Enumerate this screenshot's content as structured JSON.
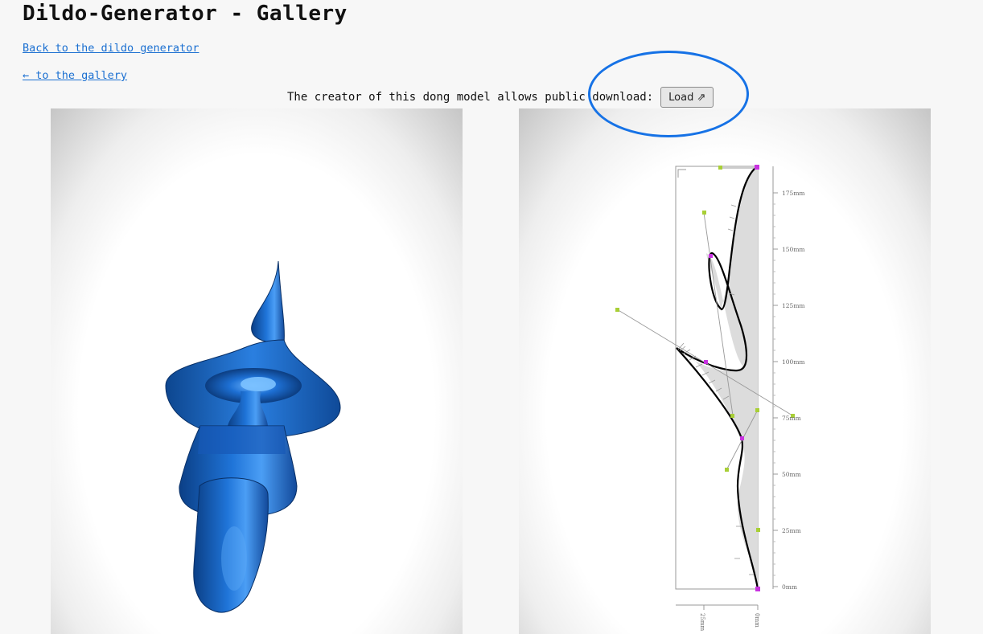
{
  "header": {
    "title": "Dildo-Generator - Gallery"
  },
  "nav": {
    "back_link": "Back to the dildo generator",
    "gallery_link": "← to the gallery"
  },
  "download": {
    "text": "The creator of this dong model allows public download:",
    "button_label": "Load ⇗"
  },
  "editor": {
    "y_ticks": [
      "175mm",
      "150mm",
      "125mm",
      "100mm",
      "75mm",
      "50mm",
      "25mm",
      "0mm"
    ],
    "x_ticks": [
      "25mm",
      "0mm"
    ]
  },
  "colors": {
    "model": "#1a66c8",
    "annotation": "#1672e6",
    "link": "#1a6fd1"
  }
}
